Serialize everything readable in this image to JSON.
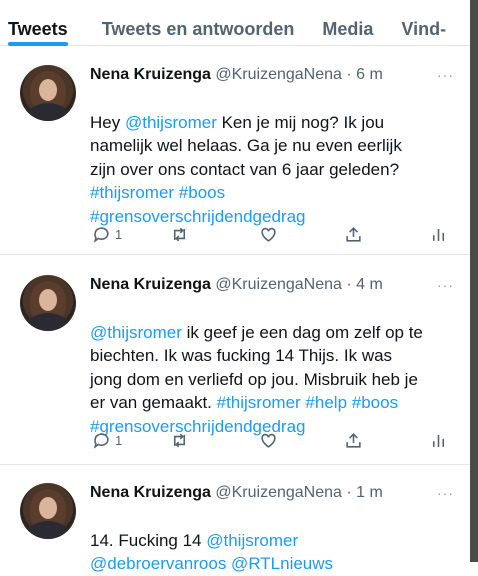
{
  "tabs": [
    {
      "label": "Tweets"
    },
    {
      "label": "Tweets en antwoorden"
    },
    {
      "label": "Media"
    },
    {
      "label": "Vind-"
    }
  ],
  "tweets": [
    {
      "name": "Nena Kruizenga",
      "handle": "@KruizengaNena",
      "time": "· 6 m",
      "segments": [
        {
          "text": "Hey ",
          "link": false
        },
        {
          "text": "@thijsromer",
          "link": true
        },
        {
          "text": "  Ken je mij nog? Ik jou\nnamelijk wel helaas. Ga je nu even eerlijk\nzijn over ons contact van 6 jaar geleden?\n",
          "link": false
        },
        {
          "text": "#thijsromer #boos\n#grensoverschrijdendgedrag",
          "link": true
        }
      ],
      "reply_count": "1"
    },
    {
      "name": "Nena Kruizenga",
      "handle": "@KruizengaNena",
      "time": "· 4 m",
      "segments": [
        {
          "text": "@thijsromer",
          "link": true
        },
        {
          "text": " ik geef je een dag om zelf op te\nbiechten. Ik was fucking 14 Thijs. Ik was\njong dom en verliefd op jou. Misbruik heb je\ner van gemaakt. ",
          "link": false
        },
        {
          "text": "#thijsromer #help #boos\n#grensoverschrijdendgedrag",
          "link": true
        }
      ],
      "reply_count": "1"
    },
    {
      "name": "Nena Kruizenga",
      "handle": "@KruizengaNena",
      "time": "· 1 m",
      "segments": [
        {
          "text": "14. Fucking 14 ",
          "link": false
        },
        {
          "text": "@thijsromer\n@debroervanroos @RTLnieuws",
          "link": true
        }
      ]
    }
  ],
  "more_icon": "···",
  "colors": {
    "accent": "#1d9bf0",
    "muted": "#536471",
    "text": "#0f1419"
  }
}
